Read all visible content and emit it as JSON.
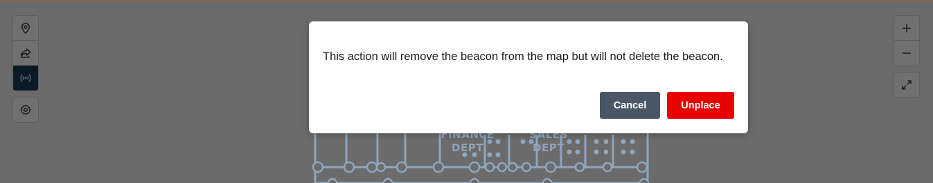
{
  "map": {
    "labels": [
      {
        "line1": "FINANCE",
        "line2": "DEPT"
      },
      {
        "line1": "SALES",
        "line2": "DEPT"
      }
    ]
  },
  "toolbar_left": {
    "items": [
      {
        "icon": "location-pin-icon",
        "active": false
      },
      {
        "icon": "share-arrow-icon",
        "active": false
      },
      {
        "icon": "beacon-signal-icon",
        "active": true
      },
      {
        "icon": "gear-icon",
        "active": false
      }
    ]
  },
  "toolbar_right": {
    "items": [
      {
        "icon": "plus-icon"
      },
      {
        "icon": "minus-icon"
      },
      {
        "icon": "expand-icon"
      }
    ]
  },
  "dialog": {
    "message": "This action will remove the beacon from the map but will not delete the beacon.",
    "cancel_label": "Cancel",
    "confirm_label": "Unplace",
    "colors": {
      "cancel": "#495665",
      "confirm": "#e60000"
    }
  }
}
